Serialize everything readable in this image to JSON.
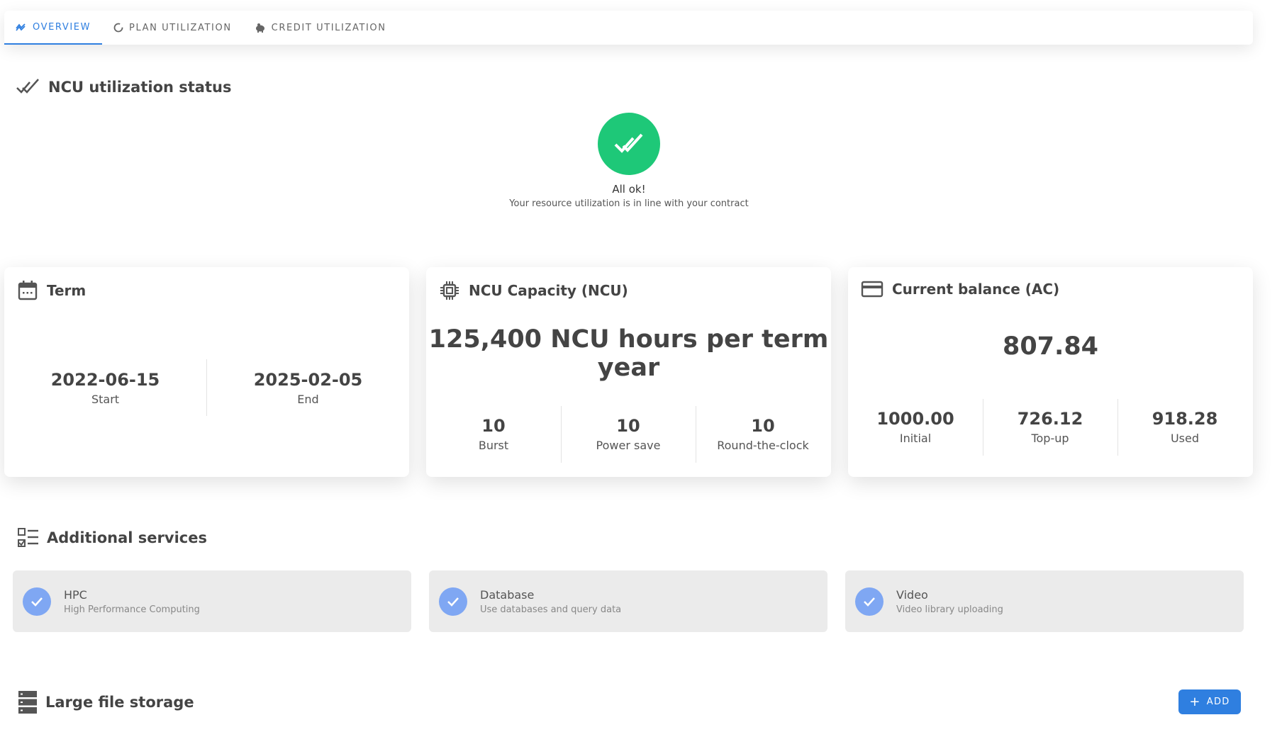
{
  "tabs": [
    {
      "label": "OVERVIEW",
      "icon": "trend-icon",
      "active": true
    },
    {
      "label": "PLAN UTILIZATION",
      "icon": "circle-progress-icon",
      "active": false
    },
    {
      "label": "CREDIT UTILIZATION",
      "icon": "piggy-bank-icon",
      "active": false
    }
  ],
  "status": {
    "section_title": "NCU utilization status",
    "title": "All ok!",
    "subtitle": "Your resource utilization is in line with your contract"
  },
  "term": {
    "title": "Term",
    "start_value": "2022-06-15",
    "start_label": "Start",
    "end_value": "2025-02-05",
    "end_label": "End"
  },
  "capacity": {
    "title": "NCU Capacity (NCU)",
    "headline_line1": "125,400 NCU hours per term",
    "headline_line2": "year",
    "stats": [
      {
        "value": "10",
        "label": "Burst"
      },
      {
        "value": "10",
        "label": "Power save"
      },
      {
        "value": "10",
        "label": "Round-the-clock"
      }
    ]
  },
  "balance": {
    "title": "Current balance (AC)",
    "total": "807.84",
    "stats": [
      {
        "value": "1000.00",
        "label": "Initial"
      },
      {
        "value": "726.12",
        "label": "Top-up"
      },
      {
        "value": "918.28",
        "label": "Used"
      }
    ]
  },
  "services": {
    "section_title": "Additional services",
    "items": [
      {
        "title": "HPC",
        "subtitle": "High Performance Computing"
      },
      {
        "title": "Database",
        "subtitle": "Use databases and query data"
      },
      {
        "title": "Video",
        "subtitle": "Video library uploading"
      }
    ]
  },
  "storage": {
    "section_title": "Large file storage",
    "add_label": "ADD"
  },
  "colors": {
    "accent": "#2f7fe0",
    "ok_green": "#1ec878",
    "service_check": "#7fa7f3"
  }
}
